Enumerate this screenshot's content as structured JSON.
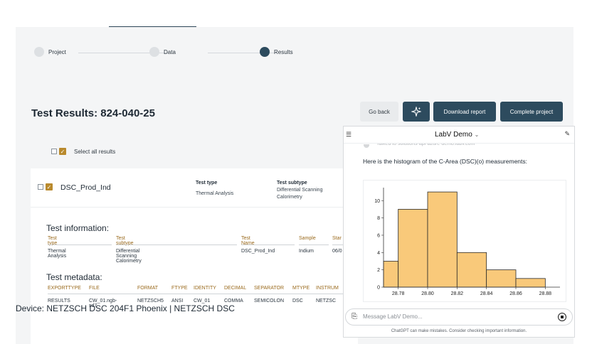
{
  "stepper": {
    "steps": [
      {
        "label": "Project"
      },
      {
        "label": "Data"
      },
      {
        "label": "Results"
      }
    ]
  },
  "page": {
    "title": "Test Results: 824-040-25"
  },
  "toolbar": {
    "back_label": "Go back",
    "magic_icon": "sparkle-icon",
    "download_label": "Download report",
    "complete_label": "Complete project"
  },
  "select_all": {
    "label": "Select all results"
  },
  "test": {
    "name": "DSC_Prod_Ind",
    "type_key": "Test type",
    "type_value": "Thermal Analysis",
    "subtype_key": "Test subtype",
    "subtype_value_1": "Differential Scanning",
    "subtype_value_2": "Calorimetry"
  },
  "info": {
    "heading": "Test information:",
    "headers": [
      "Test type",
      "Test subtype",
      "Test Name",
      "Sample",
      "Star"
    ],
    "row": [
      "Thermal Analysis",
      "Differential Scanning Calorimetry",
      "DSC_Prod_Ind",
      "Indium",
      "06/0"
    ]
  },
  "meta": {
    "heading": "Test metadata:",
    "headers": [
      "EXPORTTYPE",
      "FILE",
      "FORMAT",
      "FTYPE",
      "IDENTITY",
      "DECIMAL",
      "SEPARATOR",
      "MTYPE",
      "INSTRUM"
    ],
    "row": [
      "RESULTS",
      "CW_01.ngb-sd7",
      "NETZSCH5",
      "ANSI",
      "CW_01",
      "COMMA",
      "SEMICOLON",
      "DSC",
      "NETZSC"
    ]
  },
  "device": {
    "heading": "Device: NETZSCH DSC 204F1 Phoenix | NETZSCH DSC"
  },
  "chat": {
    "title": "LabV Demo",
    "chevron": "⌄",
    "faded_text": "Talked to solutions-api-azure-demo.labv.com",
    "message": "Here is the histogram of the C-Area (DSC)(o) measurements:",
    "placeholder": "Message LabV Demo...",
    "disclaimer": "ChatGPT can make mistakes. Consider checking important information."
  },
  "chart_data": {
    "type": "bar",
    "bins": [
      {
        "x0": 28.77,
        "x1": 28.78,
        "count": 3
      },
      {
        "x0": 28.78,
        "x1": 28.8,
        "count": 9
      },
      {
        "x0": 28.8,
        "x1": 28.82,
        "count": 11
      },
      {
        "x0": 28.82,
        "x1": 28.84,
        "count": 4
      },
      {
        "x0": 28.84,
        "x1": 28.86,
        "count": 2
      },
      {
        "x0": 28.86,
        "x1": 28.88,
        "count": 1
      }
    ],
    "x_ticks": [
      "28.78",
      "28.80",
      "28.82",
      "28.84",
      "28.86",
      "28.88"
    ],
    "y_ticks": [
      "0",
      "2",
      "4",
      "6",
      "8",
      "10"
    ],
    "xlim": [
      28.77,
      28.89
    ],
    "ylim": [
      0,
      11.5
    ],
    "bar_color": "#f9c97a",
    "edge_color": "#2a2a2a",
    "grid": false
  }
}
